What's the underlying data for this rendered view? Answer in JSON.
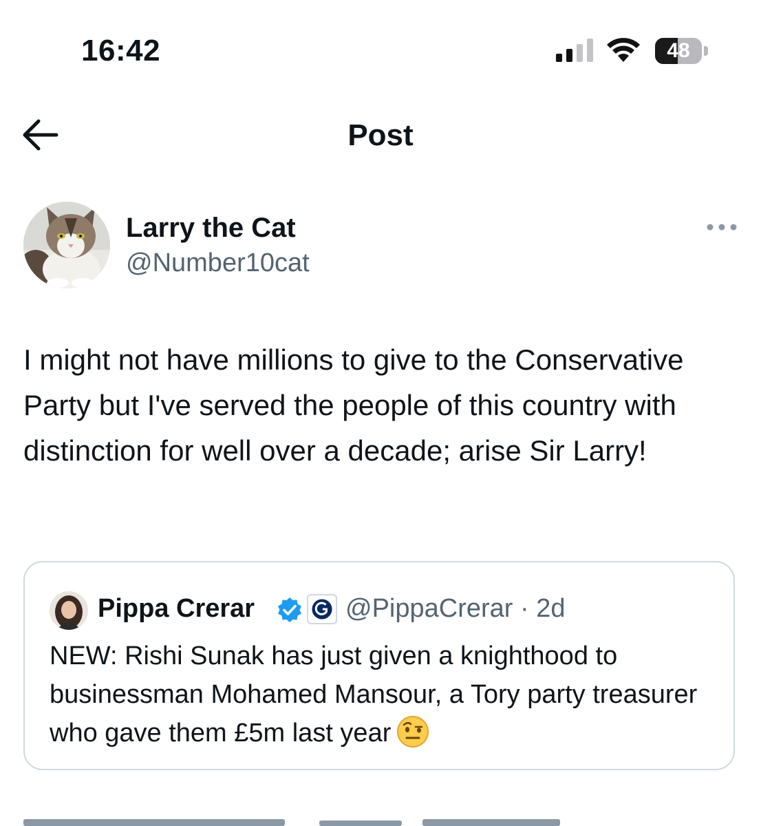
{
  "status_bar": {
    "time": "16:42",
    "battery": "48",
    "battery_level": 0.48,
    "icons": [
      "signal-icon",
      "wifi-icon",
      "battery-icon"
    ]
  },
  "header": {
    "back_icon": "arrow-left-icon",
    "title": "Post"
  },
  "post": {
    "author_name": "Larry the Cat",
    "author_handle": "@Number10cat",
    "more_icon": "more-dots-icon",
    "text": "I might not have millions to give to the Conservative Party but I've served the people of this country with distinction for well over a decade; arise Sir Larry!"
  },
  "quote": {
    "author_name": "Pippa Crerar",
    "verified_icon": "verified-badge-icon",
    "affiliate_icon": "guardian-g-icon",
    "handle_time": "@PippaCrerar · 2d",
    "text": "NEW: Rishi Sunak has just given a knighthood to businessman Mohamed Mansour, a Tory party treasurer who gave them £5m last year",
    "emoji": "face-with-raised-eyebrow-emoji"
  },
  "colors": {
    "text": "#0f1419",
    "secondary": "#536471",
    "verified": "#1d9bf0",
    "border": "#cfd9de"
  }
}
